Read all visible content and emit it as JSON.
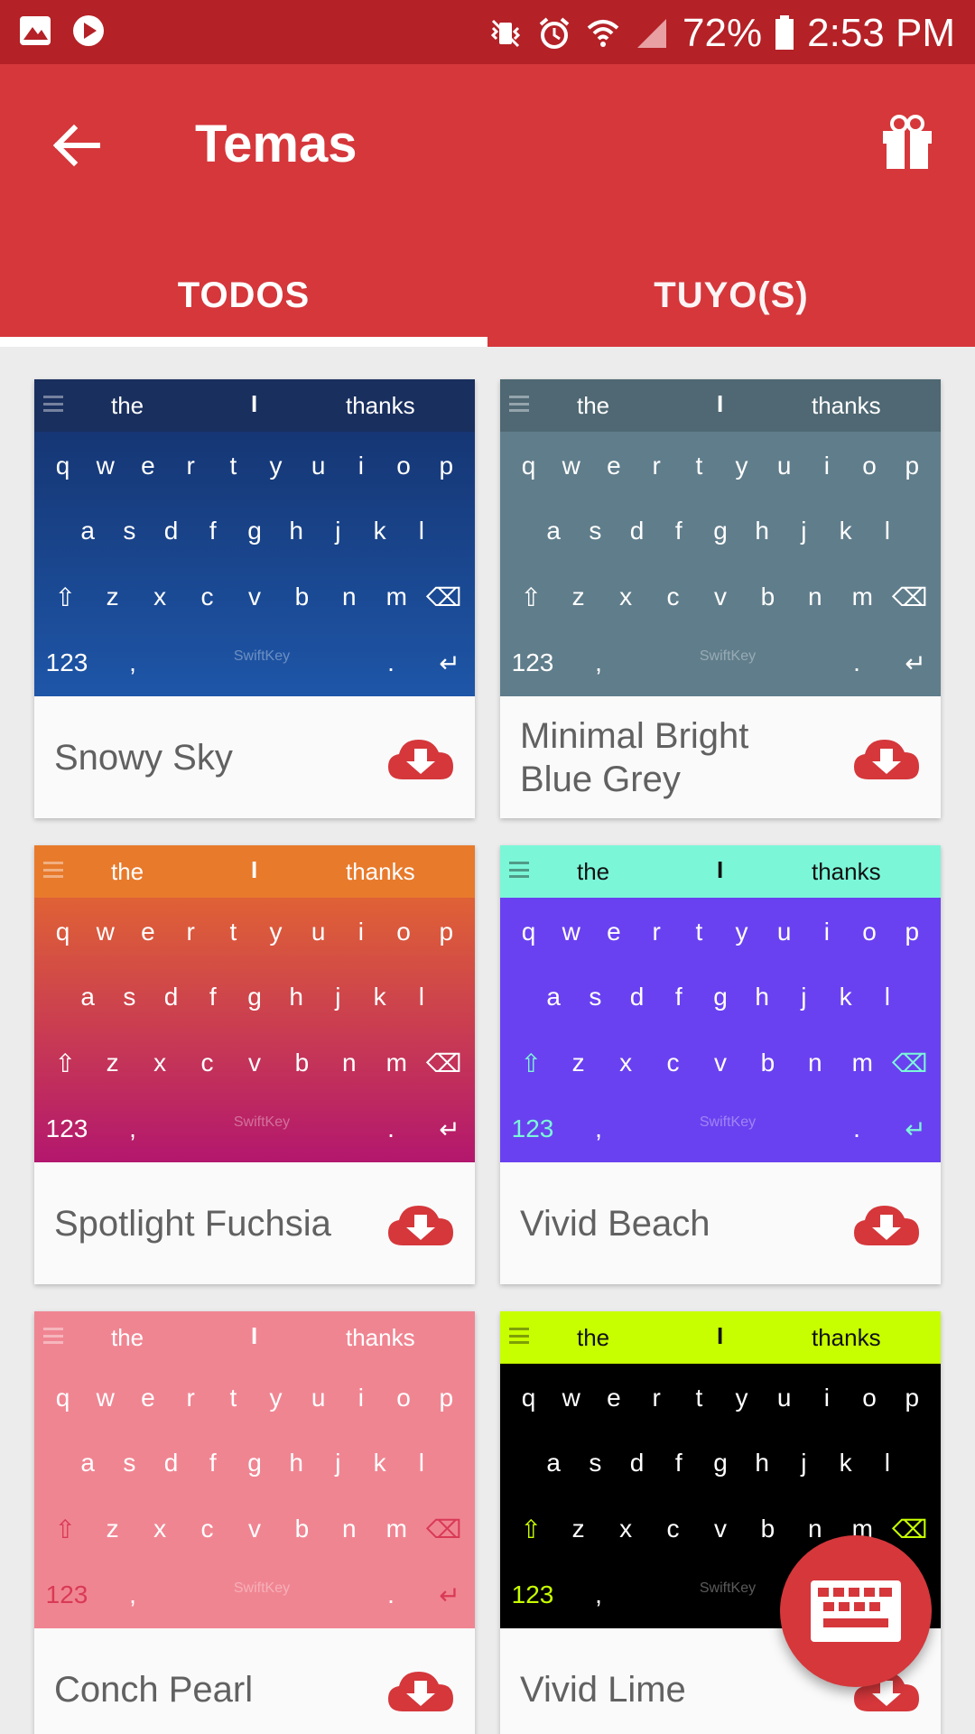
{
  "status_bar": {
    "battery": "72%",
    "time": "2:53 PM",
    "left_icons": [
      "image-icon",
      "play-icon"
    ],
    "right_icons": [
      "mute-vibrate-icon",
      "alarm-icon",
      "wifi-icon",
      "signal-icon",
      "battery-icon"
    ]
  },
  "app_bar": {
    "title": "Temas",
    "back_icon": "arrow-left-icon",
    "gift_icon": "gift-icon"
  },
  "tabs": [
    {
      "label": "TODOS",
      "selected": true
    },
    {
      "label": "TUYO(S)",
      "selected": false
    }
  ],
  "keyboard_preview": {
    "suggestions": [
      "the",
      "I",
      "thanks"
    ],
    "row1": [
      "q",
      "w",
      "e",
      "r",
      "t",
      "y",
      "u",
      "i",
      "o",
      "p"
    ],
    "row2": [
      "a",
      "s",
      "d",
      "f",
      "g",
      "h",
      "j",
      "k",
      "l"
    ],
    "row3": [
      "z",
      "x",
      "c",
      "v",
      "b",
      "n",
      "m"
    ],
    "numbers_key": "123",
    "brand": "SwiftKey"
  },
  "themes": [
    {
      "name": "Snowy Sky",
      "kb_color": "#14306a",
      "kb_color2": "#1e56a8",
      "suggest_color": "#192f5e",
      "text_color": "#ffffff"
    },
    {
      "name": "Minimal Bright Blue Grey",
      "kb_color": "#607d8b",
      "kb_color2": "#607d8b",
      "suggest_color": "#4f6873",
      "text_color": "#ffffff"
    },
    {
      "name": "Spotlight Fuchsia",
      "kb_color": "#e8702a",
      "kb_color2": "#b3176e",
      "suggest_color": "#e87a2c",
      "text_color": "#ffffff"
    },
    {
      "name": "Vivid Beach",
      "kb_color": "#6a41f0",
      "kb_color2": "#6a41f0",
      "suggest_color": "#7bf7d8",
      "text_color": "#ffffff",
      "suggest_text": "#111111",
      "accent": "#7bf7d8"
    },
    {
      "name": "Conch Pearl",
      "kb_color": "#f08592",
      "kb_color2": "#f08592",
      "suggest_color": "#f08592",
      "text_color": "#ffffff",
      "accent": "#d93a55"
    },
    {
      "name": "Vivid Lime",
      "kb_color": "#000000",
      "kb_color2": "#000000",
      "suggest_color": "#c8ff00",
      "text_color": "#ffffff",
      "suggest_text": "#111111",
      "accent": "#c8ff00"
    }
  ],
  "download_icon": "cloud-download-icon",
  "fab_icon": "keyboard-icon",
  "colors": {
    "primary": "#d5373b",
    "status_bar": "#b42126",
    "background": "#ececec",
    "card_text": "#616161"
  }
}
